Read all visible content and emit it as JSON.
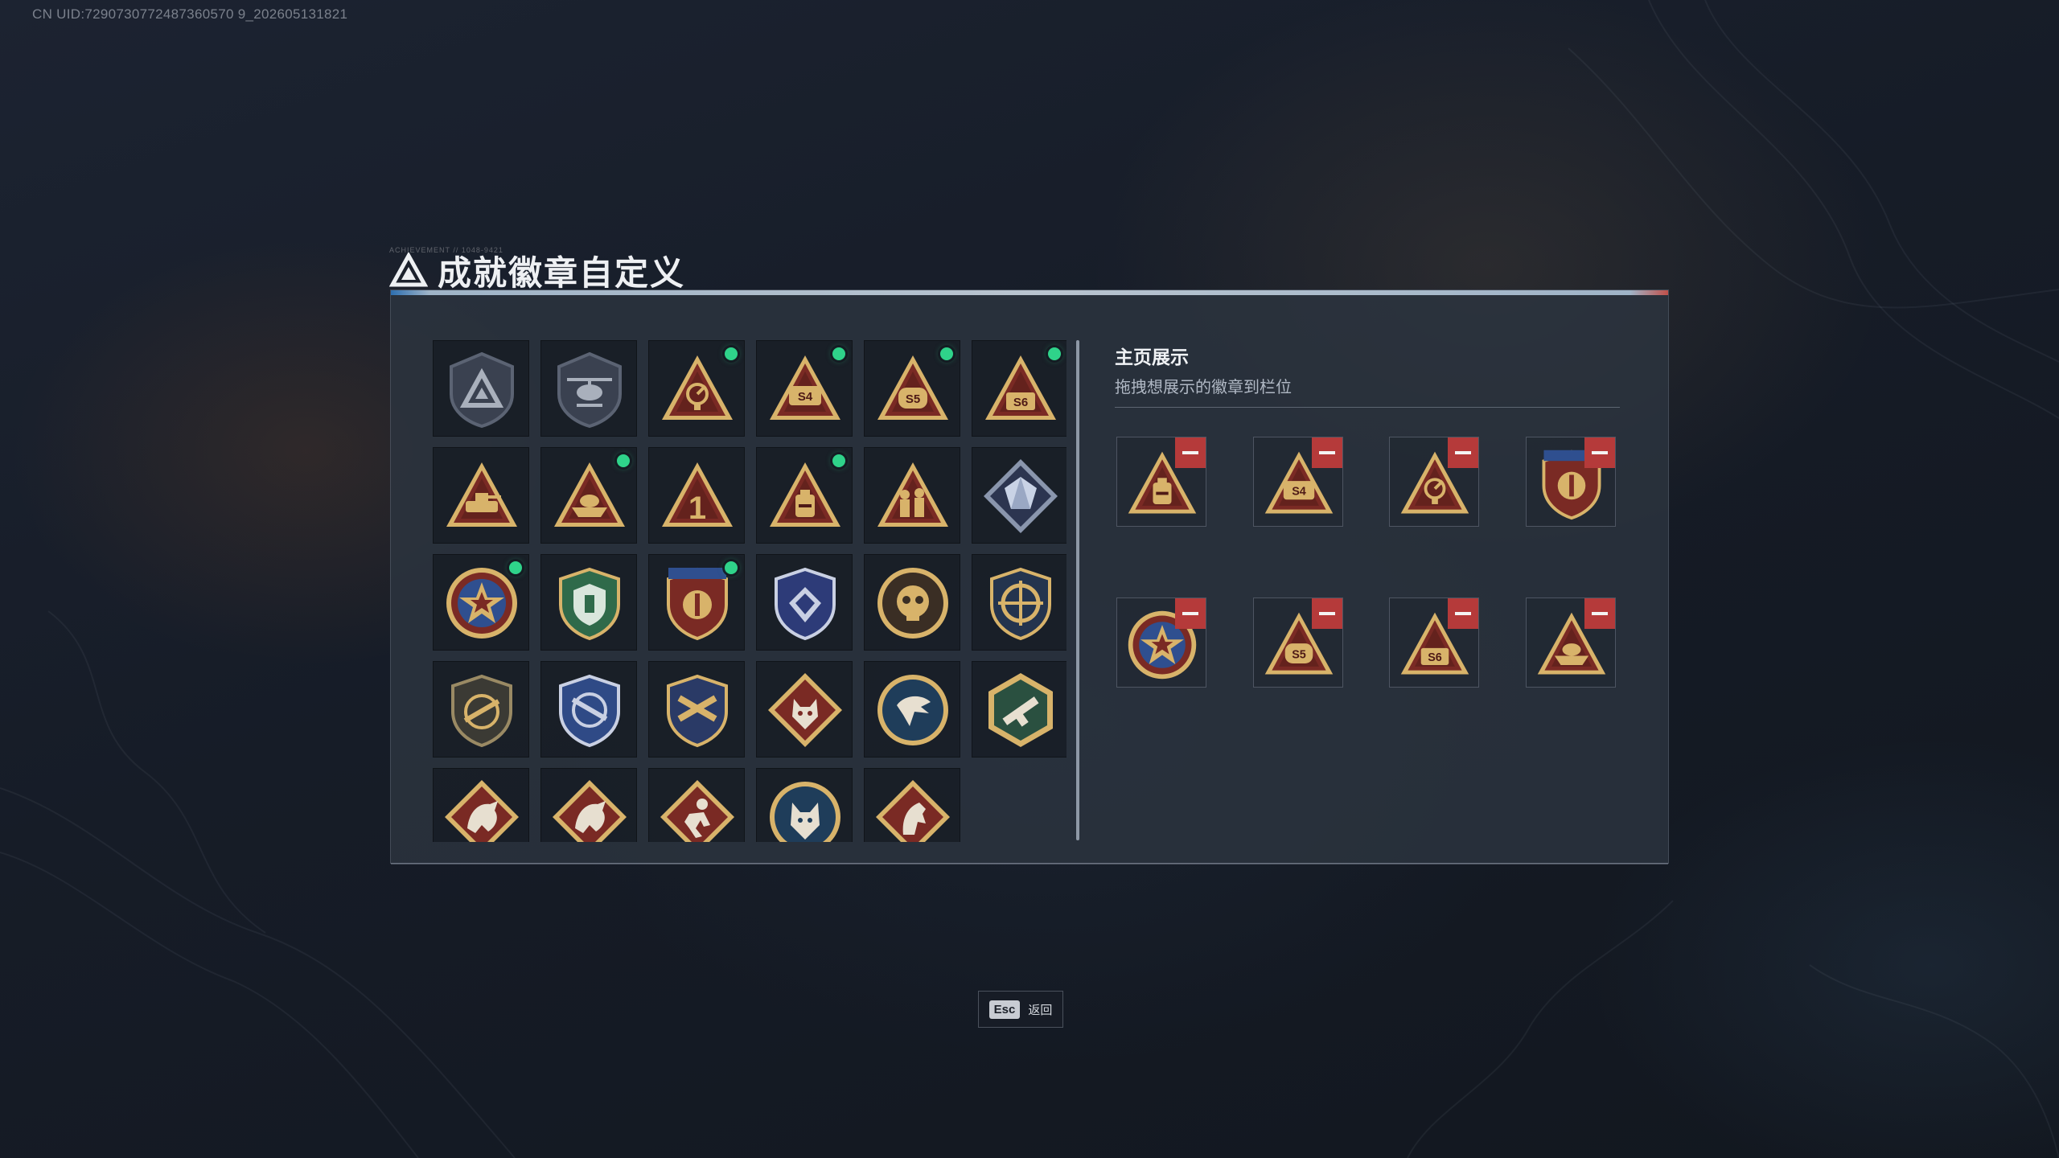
{
  "uid_text": "CN UID:7290730772487360570 9_202605131821",
  "title": "成就徽章自定义",
  "title_deco": "ACHIEVEMENT // 1048-9421",
  "right_panel": {
    "title": "主页展示",
    "subtitle": "拖拽想展示的徽章到栏位"
  },
  "esc": {
    "key": "Esc",
    "label": "返回"
  },
  "badges": [
    {
      "icon": "tri-shield-icon",
      "new": false
    },
    {
      "icon": "helicopter-shield-icon",
      "new": false
    },
    {
      "icon": "radar-triangle-icon",
      "new": true
    },
    {
      "icon": "s4-triangle-icon",
      "new": true
    },
    {
      "icon": "s5-triangle-icon",
      "new": true
    },
    {
      "icon": "s6-triangle-icon",
      "new": true
    },
    {
      "icon": "tank-triangle-icon",
      "new": false
    },
    {
      "icon": "boat-triangle-icon",
      "new": true
    },
    {
      "icon": "number-one-triangle-icon",
      "new": false
    },
    {
      "icon": "backpack-triangle-icon",
      "new": true
    },
    {
      "icon": "soldiers-triangle-icon",
      "new": false
    },
    {
      "icon": "crystal-diamond-icon",
      "new": false
    },
    {
      "icon": "star-medal-icon",
      "new": true
    },
    {
      "icon": "green-shield-icon",
      "new": false
    },
    {
      "icon": "crest-shield-icon",
      "new": true
    },
    {
      "icon": "blue-diamond-shield-icon",
      "new": false
    },
    {
      "icon": "skull-medal-icon",
      "new": false
    },
    {
      "icon": "crosshair-wreath-icon",
      "new": false
    },
    {
      "icon": "rifle-shield-icon",
      "new": false
    },
    {
      "icon": "blue-rifle-shield-icon",
      "new": false
    },
    {
      "icon": "gold-rifle-shield-icon",
      "new": false
    },
    {
      "icon": "wolf-diamond-icon",
      "new": false
    },
    {
      "icon": "eagle-round-icon",
      "new": false
    },
    {
      "icon": "gun-hexagon-icon",
      "new": false
    },
    {
      "icon": "dragon-diamond-icon",
      "new": false
    },
    {
      "icon": "dragon-diamond-icon",
      "new": false
    },
    {
      "icon": "runner-diamond-icon",
      "new": false
    },
    {
      "icon": "wolf-round-icon",
      "new": false
    },
    {
      "icon": "horse-diamond-icon",
      "new": false
    }
  ],
  "showcase": [
    {
      "icon": "backpack-triangle-icon"
    },
    {
      "icon": "s4-triangle-icon"
    },
    {
      "icon": "radar-triangle-icon"
    },
    {
      "icon": "crest-shield-icon"
    },
    {
      "icon": "star-medal-icon"
    },
    {
      "icon": "s5-triangle-icon"
    },
    {
      "icon": "s6-triangle-icon"
    },
    {
      "icon": "boat-triangle-icon"
    }
  ],
  "colors": {
    "accent_green": "#2fd38a",
    "remove_red": "#b53a3a",
    "gold": "#d8b36a",
    "triangle_red": "#7a2a24"
  }
}
